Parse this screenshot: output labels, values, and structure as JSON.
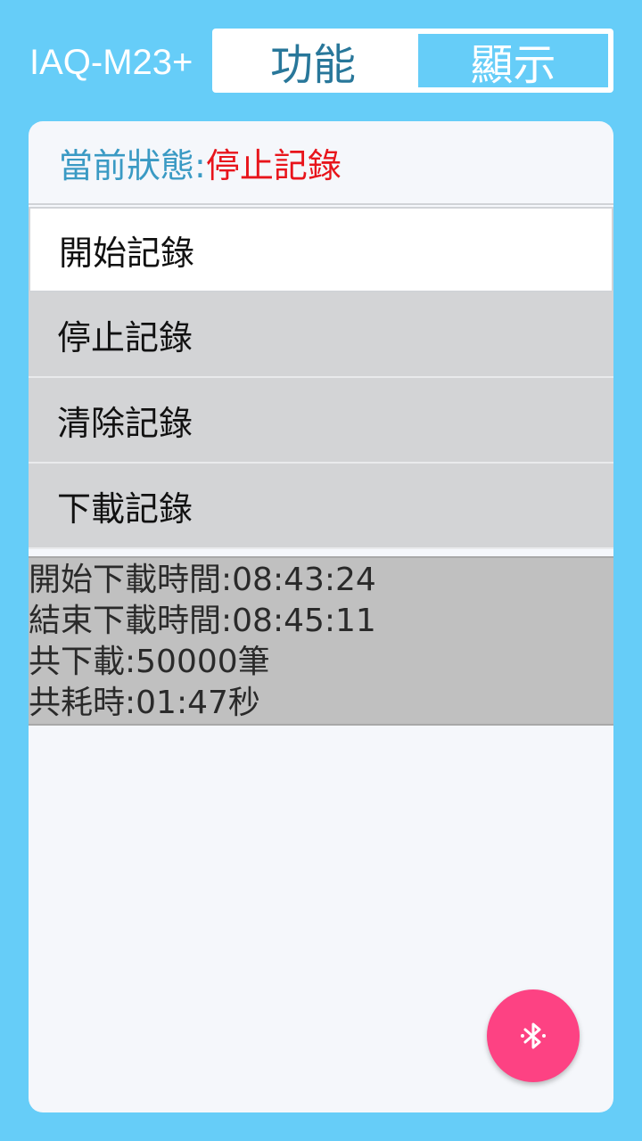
{
  "app": {
    "title": "IAQ-M23+"
  },
  "tabs": {
    "function_label": "功能",
    "display_label": "顯示"
  },
  "status": {
    "label": "當前狀態:",
    "value": "停止記錄"
  },
  "menu": {
    "items": [
      {
        "label": "開始記錄"
      },
      {
        "label": "停止記錄"
      },
      {
        "label": "清除記錄"
      },
      {
        "label": "下載記錄"
      }
    ]
  },
  "download_info": {
    "start_time": "開始下載時間:08:43:24",
    "end_time": "結束下載時間:08:45:11",
    "total_records": "共下載:50000筆",
    "elapsed": "共耗時:01:47秒"
  },
  "fab": {
    "icon": "bluetooth-icon"
  },
  "colors": {
    "background": "#66cdf8",
    "tab_text": "#28779a",
    "status_label": "#3a9ac4",
    "status_value": "#e8141b",
    "fab": "#fd4283"
  }
}
